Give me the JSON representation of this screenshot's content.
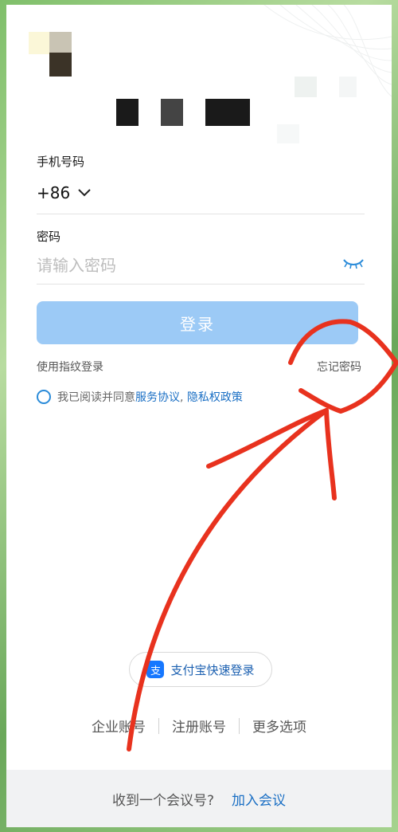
{
  "phone": {
    "label": "手机号码",
    "country_code": "+86"
  },
  "password": {
    "label": "密码",
    "placeholder": "请输入密码"
  },
  "login_button": "登录",
  "fingerprint_login": "使用指纹登录",
  "forgot_password": "忘记密码",
  "agreement": {
    "prefix": "我已阅读并同意",
    "service": "服务协议",
    "separator": ",",
    "privacy": "隐私权政策"
  },
  "alipay_login": "支付宝快速登录",
  "bottom_options": [
    "企业账号",
    "注册账号",
    "更多选项"
  ],
  "meeting": {
    "question": "收到一个会议号?",
    "join": "加入会议"
  },
  "colors": {
    "accent": "#1a6fc4",
    "login_button_bg": "#9ccaf6",
    "annotation_red": "#e8321e"
  }
}
